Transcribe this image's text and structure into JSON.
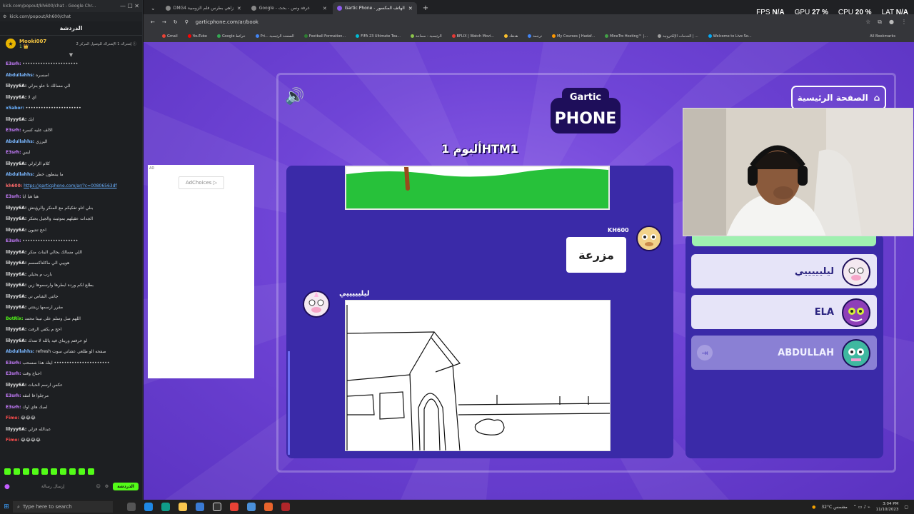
{
  "chat": {
    "title": "kick.com/popout/kh600/chat - Google Chr...",
    "url": "kick.com/popout/kh600/chat",
    "header": "الدردشة",
    "pinned_user": "Mooki007",
    "pinned_subs": "1 👑",
    "pinned_note": "إشتراك 1 الإشتراك للوصول المركز 2 ⓘ",
    "messages": [
      {
        "user": "E3srh:",
        "text": "••••••••••••••••••••••",
        "color": "#c77dff"
      },
      {
        "user": "Abdullahhs:",
        "text": "اصسره",
        "color": "#7ab7ff"
      },
      {
        "user": "lilyyy6A:",
        "text": "الي مسالك نا علو بنزلي",
        "color": "#e8e8e8"
      },
      {
        "user": "lilyyy6A:",
        "text": "اي لا",
        "color": "#e8e8e8"
      },
      {
        "user": "x5abor:",
        "text": "••••••••••••••••••••••",
        "color": "#6ab0ff"
      },
      {
        "user": "lilyyy6A:",
        "text": "ايك",
        "color": "#e8e8e8"
      },
      {
        "user": "E3srh:",
        "text": "الالف عليه كسره",
        "color": "#c77dff"
      },
      {
        "user": "Abdullahhs:",
        "text": "اليرزي",
        "color": "#7ab7ff"
      },
      {
        "user": "E3srh:",
        "text": "ايس",
        "color": "#c77dff"
      },
      {
        "user": "lilyyy6A:",
        "text": "كلام الزلزلي",
        "color": "#e8e8e8"
      },
      {
        "user": "Abdullahhs:",
        "text": "ما يبنطون خطر",
        "color": "#7ab7ff"
      },
      {
        "user": "kh600:",
        "text": "https://garticphone.com/ar/?c=00806563df",
        "color": "#ff6b6b",
        "link": true
      },
      {
        "user": "E3srh:",
        "text": "هيا هيا ايا",
        "color": "#c77dff"
      },
      {
        "user": "lilyyy6A:",
        "text": "بنلي اتلو تفكيكم مع المنكر والرؤيتش",
        "color": "#e8e8e8"
      },
      {
        "user": "lilyyy6A:",
        "text": "الجدات عقيلهم بموثيث والجيل بحتكر",
        "color": "#e8e8e8"
      },
      {
        "user": "lilyyy6A:",
        "text": "احح تنتيون",
        "color": "#e8e8e8"
      },
      {
        "user": "E3srh:",
        "text": "••••••••••••••••••••••",
        "color": "#c77dff"
      },
      {
        "user": "lilyyy6A:",
        "text": "اللي مسالك يحالي البنات منكر",
        "color": "#e8e8e8"
      },
      {
        "user": "lilyyy6A:",
        "text": "هوييي الي ماكلتاكسسم",
        "color": "#e8e8e8"
      },
      {
        "user": "lilyyy6A:",
        "text": "بارب م يحيلي",
        "color": "#e8e8e8"
      },
      {
        "user": "lilyyy6A:",
        "text": "بطلع لكم ورده ابطرها وارسموها زين",
        "color": "#e8e8e8"
      },
      {
        "user": "lilyyy6A:",
        "text": "جاتني الشاص ني",
        "color": "#e8e8e8"
      },
      {
        "user": "lilyyy6A:",
        "text": "مقرر ارسمها زينتتي",
        "color": "#e8e8e8"
      },
      {
        "user": "BotRix:",
        "text": "اللهم صل وسلم على نبينا محمد",
        "color": "#53fc18"
      },
      {
        "user": "lilyyy6A:",
        "text": "احح م يكفي الرفت",
        "color": "#e8e8e8"
      },
      {
        "user": "lilyyy6A:",
        "text": "لو حرفتم وريناي فيد يالله لا تمدك",
        "color": "#e8e8e8"
      },
      {
        "user": "Abdullahhs:",
        "text": "refresh صفحه الو طلعي عشاني سوت",
        "color": "#7ab7ff"
      },
      {
        "user": "E3srh:",
        "text": "اينك هذا صسحب ••••••••••••••••••••••",
        "color": "#c77dff"
      },
      {
        "user": "E3srh:",
        "text": "احتاج وقت",
        "color": "#c77dff"
      },
      {
        "user": "lilyyy6A:",
        "text": "عكس ارسم الحبات",
        "color": "#e8e8e8"
      },
      {
        "user": "E3srh:",
        "text": "مرجلوا فا امقه",
        "color": "#c77dff"
      },
      {
        "user": "E3srh:",
        "text": "لمبك هاي اوك",
        "color": "#c77dff"
      },
      {
        "user": "Fimo:",
        "text": "😂😂😂",
        "color": "#ff4d4d"
      },
      {
        "user": "lilyyy6A:",
        "text": "عبدالله فزلي",
        "color": "#e8e8e8"
      },
      {
        "user": "Fimo:",
        "text": "😂😂😂😂",
        "color": "#ff4d4d"
      }
    ],
    "input_placeholder": "إرسال رسالة",
    "send_label": "الدردشة"
  },
  "browser": {
    "tabs": [
      {
        "label": "DMG4 زاهي بطرس فلم الزومبية",
        "active": false
      },
      {
        "label": "Google - غرفة ونص - بحث",
        "active": false
      },
      {
        "label": "Gartic Phone - الهاتف المكسور",
        "active": true
      }
    ],
    "url": "garticphone.com/ar/book",
    "bookmarks": [
      {
        "label": "Gmail",
        "color": "#ea4335"
      },
      {
        "label": "YouTube",
        "color": "#ff0000"
      },
      {
        "label": "Google خرائط",
        "color": "#34a853"
      },
      {
        "label": "Pri... الصفحة الرئيسية",
        "color": "#4285f4"
      },
      {
        "label": "Football Formation...",
        "color": "#2e7d32"
      },
      {
        "label": "FIFA 23 Ultimate Tea...",
        "color": "#00bcd4"
      },
      {
        "label": "الرئيسية - سماحة",
        "color": "#8bc34a"
      },
      {
        "label": "BFLIX | Watch Movi...",
        "color": "#e53935"
      },
      {
        "label": "هدهك",
        "color": "#fbc02d"
      },
      {
        "label": "ترجمة",
        "color": "#4285f4"
      },
      {
        "label": "My Courses | Hadaf...",
        "color": "#ff9800"
      },
      {
        "label": "MineTro Hosting™ |...",
        "color": "#43a047"
      },
      {
        "label": "الخدمات الإلكترونية | ...",
        "color": "#9e9e9e"
      },
      {
        "label": "Welcome to Live So...",
        "color": "#03a9f4"
      }
    ],
    "all_bookmarks": "All Bookmarks",
    "perf": [
      {
        "label": "FPS",
        "value": "N/A"
      },
      {
        "label": "GPU",
        "value": "27 %"
      },
      {
        "label": "CPU",
        "value": "20 %"
      },
      {
        "label": "LAT",
        "value": "N/A"
      }
    ]
  },
  "game": {
    "home_button": "الصفحة الرئيسية",
    "logo_top": "Gartic",
    "logo_bottom": "PHONE",
    "album_title": "ألبوم 1HTM1",
    "guesser_name": "KH600",
    "guess_text": "مزرعة",
    "drawer_name": "ليليييييي",
    "players": [
      {
        "name": "ليليييييي",
        "disabled": false
      },
      {
        "name": "ELA",
        "disabled": false
      },
      {
        "name": "ABDULLAH",
        "disabled": true
      }
    ],
    "ad_tag": "AD",
    "ad_choices": "AdChoices ▷"
  },
  "taskbar": {
    "search_placeholder": "Type here to search",
    "weather": "32°C مشمس",
    "time": "3:04 PM",
    "date": "11/10/2023"
  },
  "colors": {
    "kick_green": "#53fc18",
    "gartic_purple": "#6f44d6",
    "album_bg": "#3a2aa8"
  }
}
